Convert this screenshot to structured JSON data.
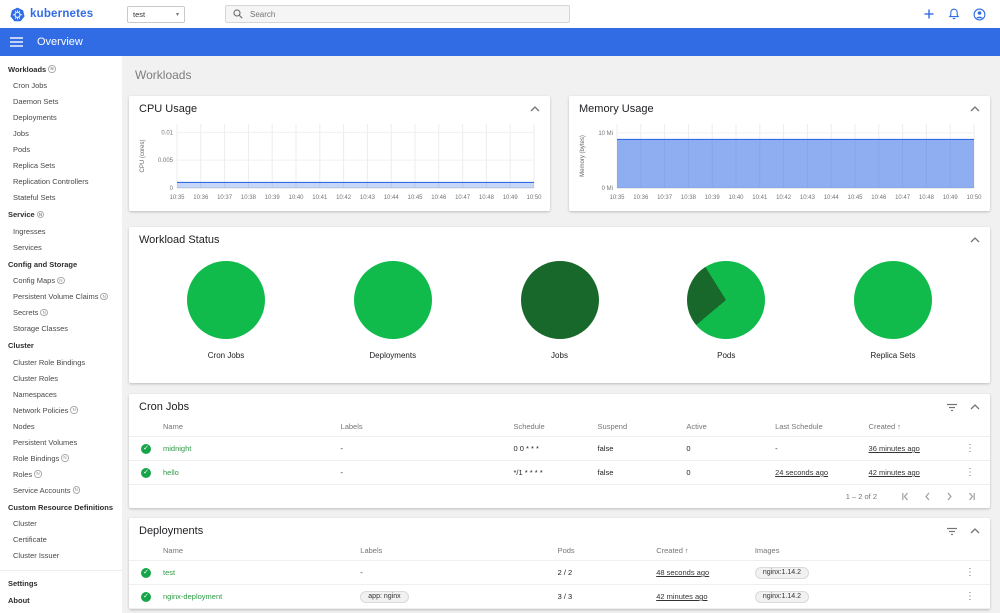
{
  "colors": {
    "brand_blue": "#326ce5",
    "link_green": "#2e9b45",
    "success_green": "#17a54a",
    "pie_green": "#10ba4b",
    "pie_dark_green": "#17682a"
  },
  "header": {
    "brand": "kubernetes",
    "namespace_selector": {
      "value": "test"
    },
    "search": {
      "placeholder": "Search"
    }
  },
  "toolbar": {
    "title": "Overview"
  },
  "sidebar": {
    "groups": [
      {
        "label": "Workloads",
        "badge": "N",
        "children": [
          {
            "label": "Cron Jobs"
          },
          {
            "label": "Daemon Sets"
          },
          {
            "label": "Deployments"
          },
          {
            "label": "Jobs"
          },
          {
            "label": "Pods"
          },
          {
            "label": "Replica Sets"
          },
          {
            "label": "Replication Controllers"
          },
          {
            "label": "Stateful Sets"
          }
        ]
      },
      {
        "label": "Service",
        "badge": "N",
        "children": [
          {
            "label": "Ingresses"
          },
          {
            "label": "Services"
          }
        ]
      },
      {
        "label": "Config and Storage",
        "children": [
          {
            "label": "Config Maps",
            "badge": "N"
          },
          {
            "label": "Persistent Volume Claims",
            "badge": "N"
          },
          {
            "label": "Secrets",
            "badge": "N"
          },
          {
            "label": "Storage Classes"
          }
        ]
      },
      {
        "label": "Cluster",
        "children": [
          {
            "label": "Cluster Role Bindings"
          },
          {
            "label": "Cluster Roles"
          },
          {
            "label": "Namespaces"
          },
          {
            "label": "Network Policies",
            "badge": "N"
          },
          {
            "label": "Nodes"
          },
          {
            "label": "Persistent Volumes"
          },
          {
            "label": "Role Bindings",
            "badge": "N"
          },
          {
            "label": "Roles",
            "badge": "N"
          },
          {
            "label": "Service Accounts",
            "badge": "N"
          }
        ]
      },
      {
        "label": "Custom Resource Definitions",
        "children": [
          {
            "label": "Cluster"
          },
          {
            "label": "Certificate"
          },
          {
            "label": "Cluster Issuer"
          }
        ]
      }
    ],
    "footer": [
      {
        "label": "Settings"
      },
      {
        "label": "About"
      }
    ]
  },
  "main": {
    "page_title": "Workloads"
  },
  "cron_jobs": {
    "title": "Cron Jobs",
    "columns": [
      "Name",
      "Labels",
      "Schedule",
      "Suspend",
      "Active",
      "Last Schedule",
      "Created"
    ],
    "sort_column": "Created",
    "rows": [
      {
        "name": "midnight",
        "labels": "-",
        "schedule": "0 0 * * *",
        "suspend": "false",
        "active": "0",
        "last_schedule": "-",
        "created": "36 minutes ago"
      },
      {
        "name": "hello",
        "labels": "-",
        "schedule": "*/1 * * * *",
        "suspend": "false",
        "active": "0",
        "last_schedule": "24 seconds ago",
        "created": "42 minutes ago"
      }
    ],
    "pagination": {
      "range_label": "1 – 2 of 2"
    }
  },
  "deployments": {
    "title": "Deployments",
    "columns": [
      "Name",
      "Labels",
      "Pods",
      "Created",
      "Images"
    ],
    "sort_column": "Created",
    "rows": [
      {
        "name": "test",
        "labels": "-",
        "pods": "2 / 2",
        "created": "48 seconds ago",
        "images": [
          "nginx:1.14.2"
        ]
      },
      {
        "name": "nginx-deployment",
        "labels": [
          "app: nginx"
        ],
        "pods": "3 / 3",
        "created": "42 minutes ago",
        "images": [
          "nginx:1.14.2"
        ]
      }
    ]
  },
  "chart_data": [
    {
      "id": "cpu-usage",
      "type": "area",
      "title": "CPU Usage",
      "ylabel": "CPU (cores)",
      "x": [
        "10:35",
        "10:36",
        "10:37",
        "10:38",
        "10:39",
        "10:40",
        "10:41",
        "10:42",
        "10:43",
        "10:44",
        "10:45",
        "10:46",
        "10:47",
        "10:48",
        "10:49",
        "10:50"
      ],
      "yticks": [
        {
          "value": 0,
          "label": "0"
        },
        {
          "value": 0.005,
          "label": "0.005"
        },
        {
          "value": 0.01,
          "label": "0.01"
        }
      ],
      "ymax": 0.0115,
      "stroke": "#326ce5",
      "fill": "rgba(50,108,229,0.28)",
      "series": [
        {
          "name": "CPU (cores)",
          "values": [
            0.001,
            0.001,
            0.001,
            0.001,
            0.001,
            0.001,
            0.001,
            0.001,
            0.001,
            0.001,
            0.001,
            0.001,
            0.001,
            0.001,
            0.001,
            0.001
          ]
        }
      ]
    },
    {
      "id": "memory-usage",
      "type": "area",
      "title": "Memory Usage",
      "ylabel": "Memory (bytes)",
      "x": [
        "10:35",
        "10:36",
        "10:37",
        "10:38",
        "10:39",
        "10:40",
        "10:41",
        "10:42",
        "10:43",
        "10:44",
        "10:45",
        "10:46",
        "10:47",
        "10:48",
        "10:49",
        "10:50"
      ],
      "yticks": [
        {
          "value": 0,
          "label": "0 Mi"
        },
        {
          "value": 10,
          "label": "10 Mi"
        }
      ],
      "ymax": 11.6,
      "stroke": "#326ce5",
      "fill": "rgba(50,108,229,0.55)",
      "series": [
        {
          "name": "Memory (bytes)",
          "values": [
            8.8,
            8.8,
            8.8,
            8.8,
            8.8,
            8.8,
            8.8,
            8.8,
            8.8,
            8.8,
            8.8,
            8.8,
            8.8,
            8.8,
            8.8,
            8.8
          ]
        }
      ]
    },
    {
      "id": "workload-status",
      "type": "pie",
      "title": "Workload Status",
      "pies": [
        {
          "label": "Cron Jobs",
          "stops": [
            [
              "#10ba4b",
              360
            ]
          ]
        },
        {
          "label": "Deployments",
          "stops": [
            [
              "#10ba4b",
              360
            ]
          ]
        },
        {
          "label": "Jobs",
          "stops": [
            [
              "#17682a",
              360
            ]
          ]
        },
        {
          "label": "Pods",
          "stops": [
            [
              "#10ba4b",
              230
            ],
            [
              "#17682a",
              328
            ],
            [
              "#10ba4b",
              360
            ]
          ]
        },
        {
          "label": "Replica Sets",
          "stops": [
            [
              "#10ba4b",
              360
            ]
          ]
        }
      ]
    }
  ]
}
